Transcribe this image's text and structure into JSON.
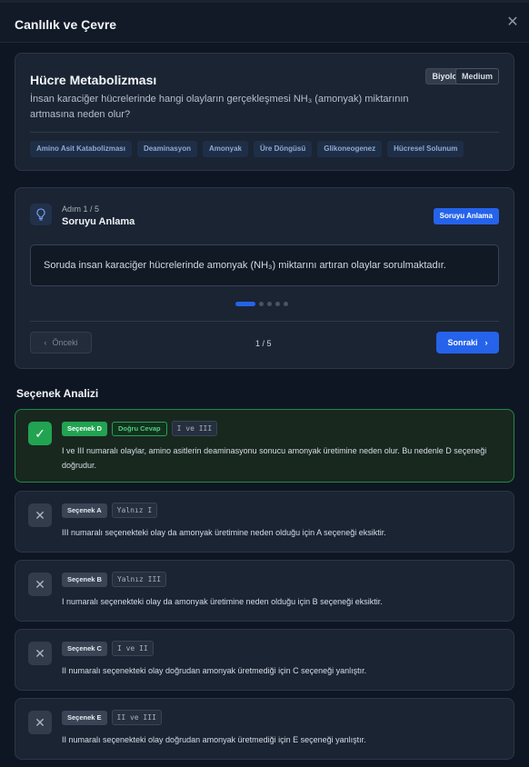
{
  "window": {
    "title": "Canlılık ve Çevre",
    "close_icon": "close-icon"
  },
  "question": {
    "title": "Hücre Metabolizması",
    "text": "İnsan karaciğer hücrelerinde hangi olayların gerçekleşmesi NH₃ (amonyak) miktarının artmasına neden olur?",
    "subject_badge": "Biyoloji",
    "difficulty_badge": "Medium",
    "tags": [
      "Amino Asit Katabolizması",
      "Deaminasyon",
      "Amonyak",
      "Üre Döngüsü",
      "Glikoneogenez",
      "Hücresel Solunum"
    ]
  },
  "stepper": {
    "icon": "lightbulb-icon",
    "step_label": "Adım 1 / 5",
    "step_title": "Soruyu Anlama",
    "step_pill": "Soruyu Anlama",
    "content": "Soruda insan karaciğer hücrelerinde amonyak (NH₃) miktarını artıran olaylar sorulmaktadır.",
    "total_steps": 5,
    "current_step": 1,
    "prev_label": "Önceki",
    "next_label": "Sonraki",
    "counter": "1 / 5"
  },
  "analysis": {
    "title": "Seçenek Analizi",
    "correct_badge": "Doğru Cevap",
    "options": [
      {
        "label": "Seçenek D",
        "code": "I ve III",
        "correct": true,
        "text": "I ve III numaralı olaylar, amino asitlerin deaminasyonu sonucu amonyak üretimine neden olur. Bu nedenle D seçeneği doğrudur."
      },
      {
        "label": "Seçenek A",
        "code": "Yalnız I",
        "correct": false,
        "text": "III numaralı seçenekteki olay da amonyak üretimine neden olduğu için A seçeneği eksiktir."
      },
      {
        "label": "Seçenek B",
        "code": "Yalnız III",
        "correct": false,
        "text": "I numaralı seçenekteki olay da amonyak üretimine neden olduğu için B seçeneği eksiktir."
      },
      {
        "label": "Seçenek C",
        "code": "I ve II",
        "correct": false,
        "text": "II numaralı seçenekteki olay doğrudan amonyak üretmediği için C seçeneği yanlıştır."
      },
      {
        "label": "Seçenek E",
        "code": "II ve III",
        "correct": false,
        "text": "II numaralı seçenekteki olay doğrudan amonyak üretmediği için E seçeneği yanlıştır."
      }
    ]
  },
  "colors": {
    "accent": "#2563eb",
    "success": "#22a352",
    "background": "#0f1623",
    "card": "#1b2433"
  }
}
